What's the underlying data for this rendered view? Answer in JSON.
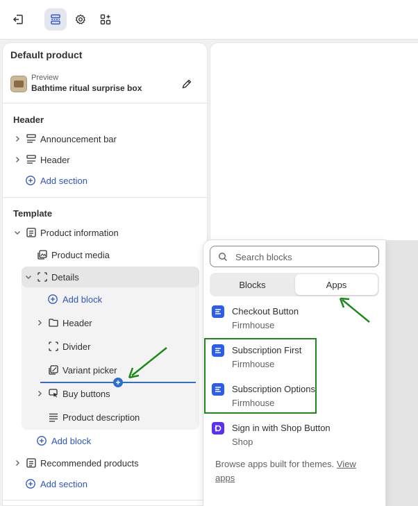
{
  "topbar": {
    "exit_icon": "exit-icon",
    "sections_icon": "sections-icon",
    "settings_icon": "gear-icon",
    "apps_icon": "apps-icon"
  },
  "sidebar": {
    "title": "Default product",
    "preview": {
      "label": "Preview",
      "value": "Bathtime ritual surprise box"
    },
    "header_group": {
      "title": "Header",
      "items": [
        {
          "label": "Announcement bar"
        },
        {
          "label": "Header"
        }
      ],
      "add_section": "Add section"
    },
    "template_group": {
      "title": "Template",
      "product_information": "Product information",
      "product_media": "Product media",
      "details": "Details",
      "details_add_block": "Add block",
      "details_children": [
        {
          "label": "Header"
        },
        {
          "label": "Divider"
        },
        {
          "label": "Variant picker"
        },
        {
          "label": "Buy buttons"
        },
        {
          "label": "Product description"
        }
      ],
      "add_block": "Add block",
      "recommended_products": "Recommended products",
      "add_section": "Add section"
    }
  },
  "popover": {
    "search": {
      "placeholder": "Search blocks",
      "value": ""
    },
    "tabs": [
      {
        "label": "Blocks",
        "selected": false
      },
      {
        "label": "Apps",
        "selected": true
      }
    ],
    "apps": [
      {
        "name": "Checkout Button",
        "vendor": "Firmhouse"
      },
      {
        "name": "Subscription First",
        "vendor": "Firmhouse"
      },
      {
        "name": "Subscription Options",
        "vendor": "Firmhouse"
      },
      {
        "name": "Sign in with Shop Button",
        "vendor": "Shop"
      }
    ],
    "browse_text": "Browse apps built for themes.",
    "browse_link": "View apps"
  },
  "colors": {
    "accent_blue": "#2c55c7",
    "insert_line": "#2c6ecb",
    "annotation_green": "#1a8a1a",
    "firmhouse_icon": "#2b5df0",
    "shop_icon": "#5a31f4"
  }
}
